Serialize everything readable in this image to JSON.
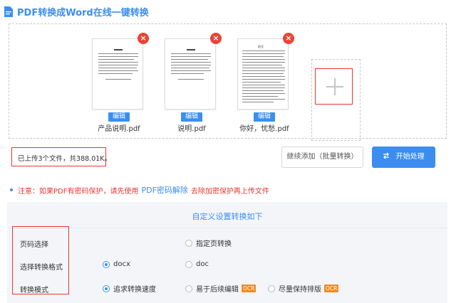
{
  "header": {
    "title": "PDF转换成Word在线一键转换",
    "icon": "document-icon"
  },
  "files": [
    {
      "name": "产品说明.pdf",
      "edit_label": "编辑",
      "delete_label": "×",
      "doc_title": ""
    },
    {
      "name": "说明.pdf",
      "edit_label": "编辑",
      "delete_label": "×",
      "doc_title": ""
    },
    {
      "name": "你好，忧愁.pdf",
      "edit_label": "编辑",
      "delete_label": "×",
      "doc_title": "前言"
    }
  ],
  "upload": {
    "add_icon": "plus-icon",
    "status": "已上传3个文件，共388.01K。",
    "continue_label": "继续添加（批量转换）",
    "start_label": "开始处理",
    "start_icon": "swap-arrows-icon"
  },
  "notice": {
    "prefix": "注意：如果PDF有密码保护，请先使用",
    "link": "PDF密码解除",
    "suffix": "去除加密保护再上传文件"
  },
  "settings": {
    "title": "自定义设置转换如下",
    "rows": [
      {
        "label": "页码选择",
        "options": [
          {
            "label": "指定页转换",
            "checked": false
          }
        ]
      },
      {
        "label": "选择转换格式",
        "options": [
          {
            "label": "docx",
            "checked": true
          },
          {
            "label": "doc",
            "checked": false
          }
        ]
      },
      {
        "label": "转换模式",
        "options": [
          {
            "label": "追求转换速度",
            "checked": true
          },
          {
            "label": "易于后续编辑",
            "checked": false,
            "badge": "OCR"
          },
          {
            "label": "尽量保持排版",
            "checked": false,
            "badge": "OCR"
          }
        ]
      }
    ]
  },
  "colors": {
    "accent": "#3b8ef0",
    "danger": "#e53935",
    "badge": "#f58a1f"
  }
}
